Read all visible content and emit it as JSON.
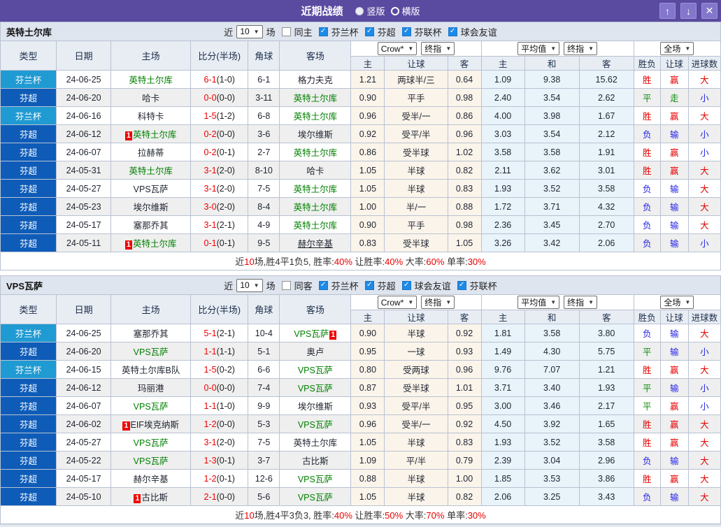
{
  "titlebar": {
    "title": "近期战绩",
    "vertical_label": "竖版",
    "horizontal_label": "横版",
    "vertical_selected": true,
    "up_icon": "↑",
    "down_icon": "↓",
    "close_icon": "✕"
  },
  "colors": {
    "titlebar_purple": "#5a4aa0",
    "cup_badge_blue": "#209ad2",
    "league_badge_blue": "#0e5cb8",
    "focus_team_green": "#008000",
    "win_red": "#e60000",
    "lose_blue": "#2323e6",
    "draw_green": "#0a8a0a",
    "checkbox_blue": "#1e8ae6"
  },
  "columns": {
    "main": [
      "类型",
      "日期",
      "主场",
      "比分(半场)",
      "角球",
      "客场"
    ],
    "odds_group": [
      "主",
      "让球",
      "客"
    ],
    "avg_group": [
      "主",
      "和",
      "客"
    ],
    "result_group": [
      "胜负",
      "让球",
      "进球数"
    ]
  },
  "tables": [
    {
      "team": "英特土尔库",
      "filter": {
        "near_label": "近",
        "match_count": "10",
        "games_label": "场",
        "same_side": {
          "label": "同主",
          "checked": false
        },
        "leagues": [
          {
            "label": "芬兰杯",
            "checked": true
          },
          {
            "label": "芬超",
            "checked": true
          },
          {
            "label": "芬联杯",
            "checked": true
          },
          {
            "label": "球会友谊",
            "checked": true
          }
        ]
      },
      "selectors": {
        "odds_company": "Crow*",
        "odds_stage": "终指",
        "avg_source": "平均值",
        "avg_stage": "终指",
        "scope": "全场"
      },
      "rows": [
        {
          "type": "芬兰杯",
          "date": "24-06-25",
          "home": {
            "name": "英特土尔库",
            "focus": true
          },
          "score": "6-1",
          "half": "(1-0)",
          "corner": "6-1",
          "away": {
            "name": "格力夫克"
          },
          "odds": [
            "1.21",
            "两球半/三",
            "0.64"
          ],
          "avg": [
            "1.09",
            "9.38",
            "15.62"
          ],
          "results": [
            "胜",
            "赢",
            "大"
          ]
        },
        {
          "type": "芬超",
          "date": "24-06-20",
          "home": {
            "name": "哈卡"
          },
          "score": "0-0",
          "half": "(0-0)",
          "corner": "3-11",
          "away": {
            "name": "英特土尔库",
            "focus": true
          },
          "odds": [
            "0.90",
            "平手",
            "0.98"
          ],
          "avg": [
            "2.40",
            "3.54",
            "2.62"
          ],
          "results": [
            "平",
            "走",
            "小"
          ]
        },
        {
          "type": "芬兰杯",
          "date": "24-06-16",
          "home": {
            "name": "科特卡"
          },
          "score": "1-5",
          "half": "(1-2)",
          "corner": "6-8",
          "away": {
            "name": "英特土尔库",
            "focus": true
          },
          "odds": [
            "0.96",
            "受半/一",
            "0.86"
          ],
          "avg": [
            "4.00",
            "3.98",
            "1.67"
          ],
          "results": [
            "胜",
            "赢",
            "大"
          ]
        },
        {
          "type": "芬超",
          "date": "24-06-12",
          "home": {
            "name": "英特土尔库",
            "focus": true,
            "red": "before"
          },
          "score": "0-2",
          "half": "(0-0)",
          "corner": "3-6",
          "away": {
            "name": "埃尔维斯"
          },
          "odds": [
            "0.92",
            "受平/半",
            "0.96"
          ],
          "avg": [
            "3.03",
            "3.54",
            "2.12"
          ],
          "results": [
            "负",
            "输",
            "小"
          ]
        },
        {
          "type": "芬超",
          "date": "24-06-07",
          "home": {
            "name": "拉赫蒂"
          },
          "score": "0-2",
          "half": "(0-1)",
          "corner": "2-7",
          "away": {
            "name": "英特土尔库",
            "focus": true
          },
          "odds": [
            "0.86",
            "受半球",
            "1.02"
          ],
          "avg": [
            "3.58",
            "3.58",
            "1.91"
          ],
          "results": [
            "胜",
            "赢",
            "小"
          ]
        },
        {
          "type": "芬超",
          "date": "24-05-31",
          "home": {
            "name": "英特土尔库",
            "focus": true
          },
          "score": "3-1",
          "half": "(2-0)",
          "corner": "8-10",
          "away": {
            "name": "哈卡"
          },
          "odds": [
            "1.05",
            "半球",
            "0.82"
          ],
          "avg": [
            "2.11",
            "3.62",
            "3.01"
          ],
          "results": [
            "胜",
            "赢",
            "大"
          ]
        },
        {
          "type": "芬超",
          "date": "24-05-27",
          "home": {
            "name": "VPS瓦萨"
          },
          "score": "3-1",
          "half": "(2-0)",
          "corner": "7-5",
          "away": {
            "name": "英特土尔库",
            "focus": true
          },
          "odds": [
            "1.05",
            "半球",
            "0.83"
          ],
          "avg": [
            "1.93",
            "3.52",
            "3.58"
          ],
          "results": [
            "负",
            "输",
            "大"
          ]
        },
        {
          "type": "芬超",
          "date": "24-05-23",
          "home": {
            "name": "埃尔维斯"
          },
          "score": "3-0",
          "half": "(2-0)",
          "corner": "8-4",
          "away": {
            "name": "英特土尔库",
            "focus": true
          },
          "odds": [
            "1.00",
            "半/一",
            "0.88"
          ],
          "avg": [
            "1.72",
            "3.71",
            "4.32"
          ],
          "results": [
            "负",
            "输",
            "大"
          ]
        },
        {
          "type": "芬超",
          "date": "24-05-17",
          "home": {
            "name": "塞那乔其"
          },
          "score": "3-1",
          "half": "(2-1)",
          "corner": "4-9",
          "away": {
            "name": "英特土尔库",
            "focus": true
          },
          "odds": [
            "0.90",
            "平手",
            "0.98"
          ],
          "avg": [
            "2.36",
            "3.45",
            "2.70"
          ],
          "results": [
            "负",
            "输",
            "大"
          ]
        },
        {
          "type": "芬超",
          "date": "24-05-11",
          "home": {
            "name": "英特土尔库",
            "focus": true,
            "red": "before"
          },
          "score": "0-1",
          "half": "(0-1)",
          "corner": "9-5",
          "away": {
            "name": "赫尔辛基",
            "underline": true
          },
          "odds": [
            "0.83",
            "受半球",
            "1.05"
          ],
          "avg": [
            "3.26",
            "3.42",
            "2.06"
          ],
          "results": [
            "负",
            "输",
            "小"
          ]
        }
      ],
      "summary": [
        {
          "text": "近",
          "red": false
        },
        {
          "text": "10",
          "red": true
        },
        {
          "text": "场,胜4平1负5, 胜率:",
          "red": false
        },
        {
          "text": "40%",
          "red": true
        },
        {
          "text": " 让胜率:",
          "red": false
        },
        {
          "text": "40%",
          "red": true
        },
        {
          "text": " 大率:",
          "red": false
        },
        {
          "text": "60%",
          "red": true
        },
        {
          "text": " 单率:",
          "red": false
        },
        {
          "text": "30%",
          "red": true
        }
      ]
    },
    {
      "team": "VPS瓦萨",
      "filter": {
        "near_label": "近",
        "match_count": "10",
        "games_label": "场",
        "same_side": {
          "label": "同客",
          "checked": false
        },
        "leagues": [
          {
            "label": "芬兰杯",
            "checked": true
          },
          {
            "label": "芬超",
            "checked": true
          },
          {
            "label": "球会友谊",
            "checked": true
          },
          {
            "label": "芬联杯",
            "checked": true
          }
        ]
      },
      "selectors": {
        "odds_company": "Crow*",
        "odds_stage": "终指",
        "avg_source": "平均值",
        "avg_stage": "终指",
        "scope": "全场"
      },
      "rows": [
        {
          "type": "芬兰杯",
          "date": "24-06-25",
          "home": {
            "name": "塞那乔其"
          },
          "score": "5-1",
          "half": "(2-1)",
          "corner": "10-4",
          "away": {
            "name": "VPS瓦萨",
            "focus": true,
            "red": "after"
          },
          "odds": [
            "0.90",
            "半球",
            "0.92"
          ],
          "avg": [
            "1.81",
            "3.58",
            "3.80"
          ],
          "results": [
            "负",
            "输",
            "大"
          ]
        },
        {
          "type": "芬超",
          "date": "24-06-20",
          "home": {
            "name": "VPS瓦萨",
            "focus": true
          },
          "score": "1-1",
          "half": "(1-1)",
          "corner": "5-1",
          "away": {
            "name": "奥卢"
          },
          "odds": [
            "0.95",
            "一球",
            "0.93"
          ],
          "avg": [
            "1.49",
            "4.30",
            "5.75"
          ],
          "results": [
            "平",
            "输",
            "小"
          ]
        },
        {
          "type": "芬兰杯",
          "date": "24-06-15",
          "home": {
            "name": "英特土尔库B队"
          },
          "score": "1-5",
          "half": "(0-2)",
          "corner": "6-6",
          "away": {
            "name": "VPS瓦萨",
            "focus": true
          },
          "odds": [
            "0.80",
            "受两球",
            "0.96"
          ],
          "avg": [
            "9.76",
            "7.07",
            "1.21"
          ],
          "results": [
            "胜",
            "赢",
            "大"
          ]
        },
        {
          "type": "芬超",
          "date": "24-06-12",
          "home": {
            "name": "玛丽港"
          },
          "score": "0-0",
          "half": "(0-0)",
          "corner": "7-4",
          "away": {
            "name": "VPS瓦萨",
            "focus": true
          },
          "odds": [
            "0.87",
            "受半球",
            "1.01"
          ],
          "avg": [
            "3.71",
            "3.40",
            "1.93"
          ],
          "results": [
            "平",
            "输",
            "小"
          ]
        },
        {
          "type": "芬超",
          "date": "24-06-07",
          "home": {
            "name": "VPS瓦萨",
            "focus": true
          },
          "score": "1-1",
          "half": "(1-0)",
          "corner": "9-9",
          "away": {
            "name": "埃尔维斯"
          },
          "odds": [
            "0.93",
            "受平/半",
            "0.95"
          ],
          "avg": [
            "3.00",
            "3.46",
            "2.17"
          ],
          "results": [
            "平",
            "赢",
            "小"
          ]
        },
        {
          "type": "芬超",
          "date": "24-06-02",
          "home": {
            "name": "EIF埃克纳斯",
            "red": "before"
          },
          "score": "1-2",
          "half": "(0-0)",
          "corner": "5-3",
          "away": {
            "name": "VPS瓦萨",
            "focus": true
          },
          "odds": [
            "0.96",
            "受半/一",
            "0.92"
          ],
          "avg": [
            "4.50",
            "3.92",
            "1.65"
          ],
          "results": [
            "胜",
            "赢",
            "大"
          ]
        },
        {
          "type": "芬超",
          "date": "24-05-27",
          "home": {
            "name": "VPS瓦萨",
            "focus": true
          },
          "score": "3-1",
          "half": "(2-0)",
          "corner": "7-5",
          "away": {
            "name": "英特土尔库"
          },
          "odds": [
            "1.05",
            "半球",
            "0.83"
          ],
          "avg": [
            "1.93",
            "3.52",
            "3.58"
          ],
          "results": [
            "胜",
            "赢",
            "大"
          ]
        },
        {
          "type": "芬超",
          "date": "24-05-22",
          "home": {
            "name": "VPS瓦萨",
            "focus": true
          },
          "score": "1-3",
          "half": "(0-1)",
          "corner": "3-7",
          "away": {
            "name": "古比斯"
          },
          "odds": [
            "1.09",
            "平/半",
            "0.79"
          ],
          "avg": [
            "2.39",
            "3.04",
            "2.96"
          ],
          "results": [
            "负",
            "输",
            "大"
          ]
        },
        {
          "type": "芬超",
          "date": "24-05-17",
          "home": {
            "name": "赫尔辛基"
          },
          "score": "1-2",
          "half": "(0-1)",
          "corner": "12-6",
          "away": {
            "name": "VPS瓦萨",
            "focus": true
          },
          "odds": [
            "0.88",
            "半球",
            "1.00"
          ],
          "avg": [
            "1.85",
            "3.53",
            "3.86"
          ],
          "results": [
            "胜",
            "赢",
            "大"
          ]
        },
        {
          "type": "芬超",
          "date": "24-05-10",
          "home": {
            "name": "古比斯",
            "red": "before"
          },
          "score": "2-1",
          "half": "(0-0)",
          "corner": "5-6",
          "away": {
            "name": "VPS瓦萨",
            "focus": true
          },
          "odds": [
            "1.05",
            "半球",
            "0.82"
          ],
          "avg": [
            "2.06",
            "3.25",
            "3.43"
          ],
          "results": [
            "负",
            "输",
            "大"
          ]
        }
      ],
      "summary": [
        {
          "text": "近",
          "red": false
        },
        {
          "text": "10",
          "red": true
        },
        {
          "text": "场,胜4平3负3, 胜率:",
          "red": false
        },
        {
          "text": "40%",
          "red": true
        },
        {
          "text": " 让胜率:",
          "red": false
        },
        {
          "text": "50%",
          "red": true
        },
        {
          "text": " 大率:",
          "red": false
        },
        {
          "text": "70%",
          "red": true
        },
        {
          "text": " 单率:",
          "red": false
        },
        {
          "text": "30%",
          "red": true
        }
      ]
    }
  ]
}
